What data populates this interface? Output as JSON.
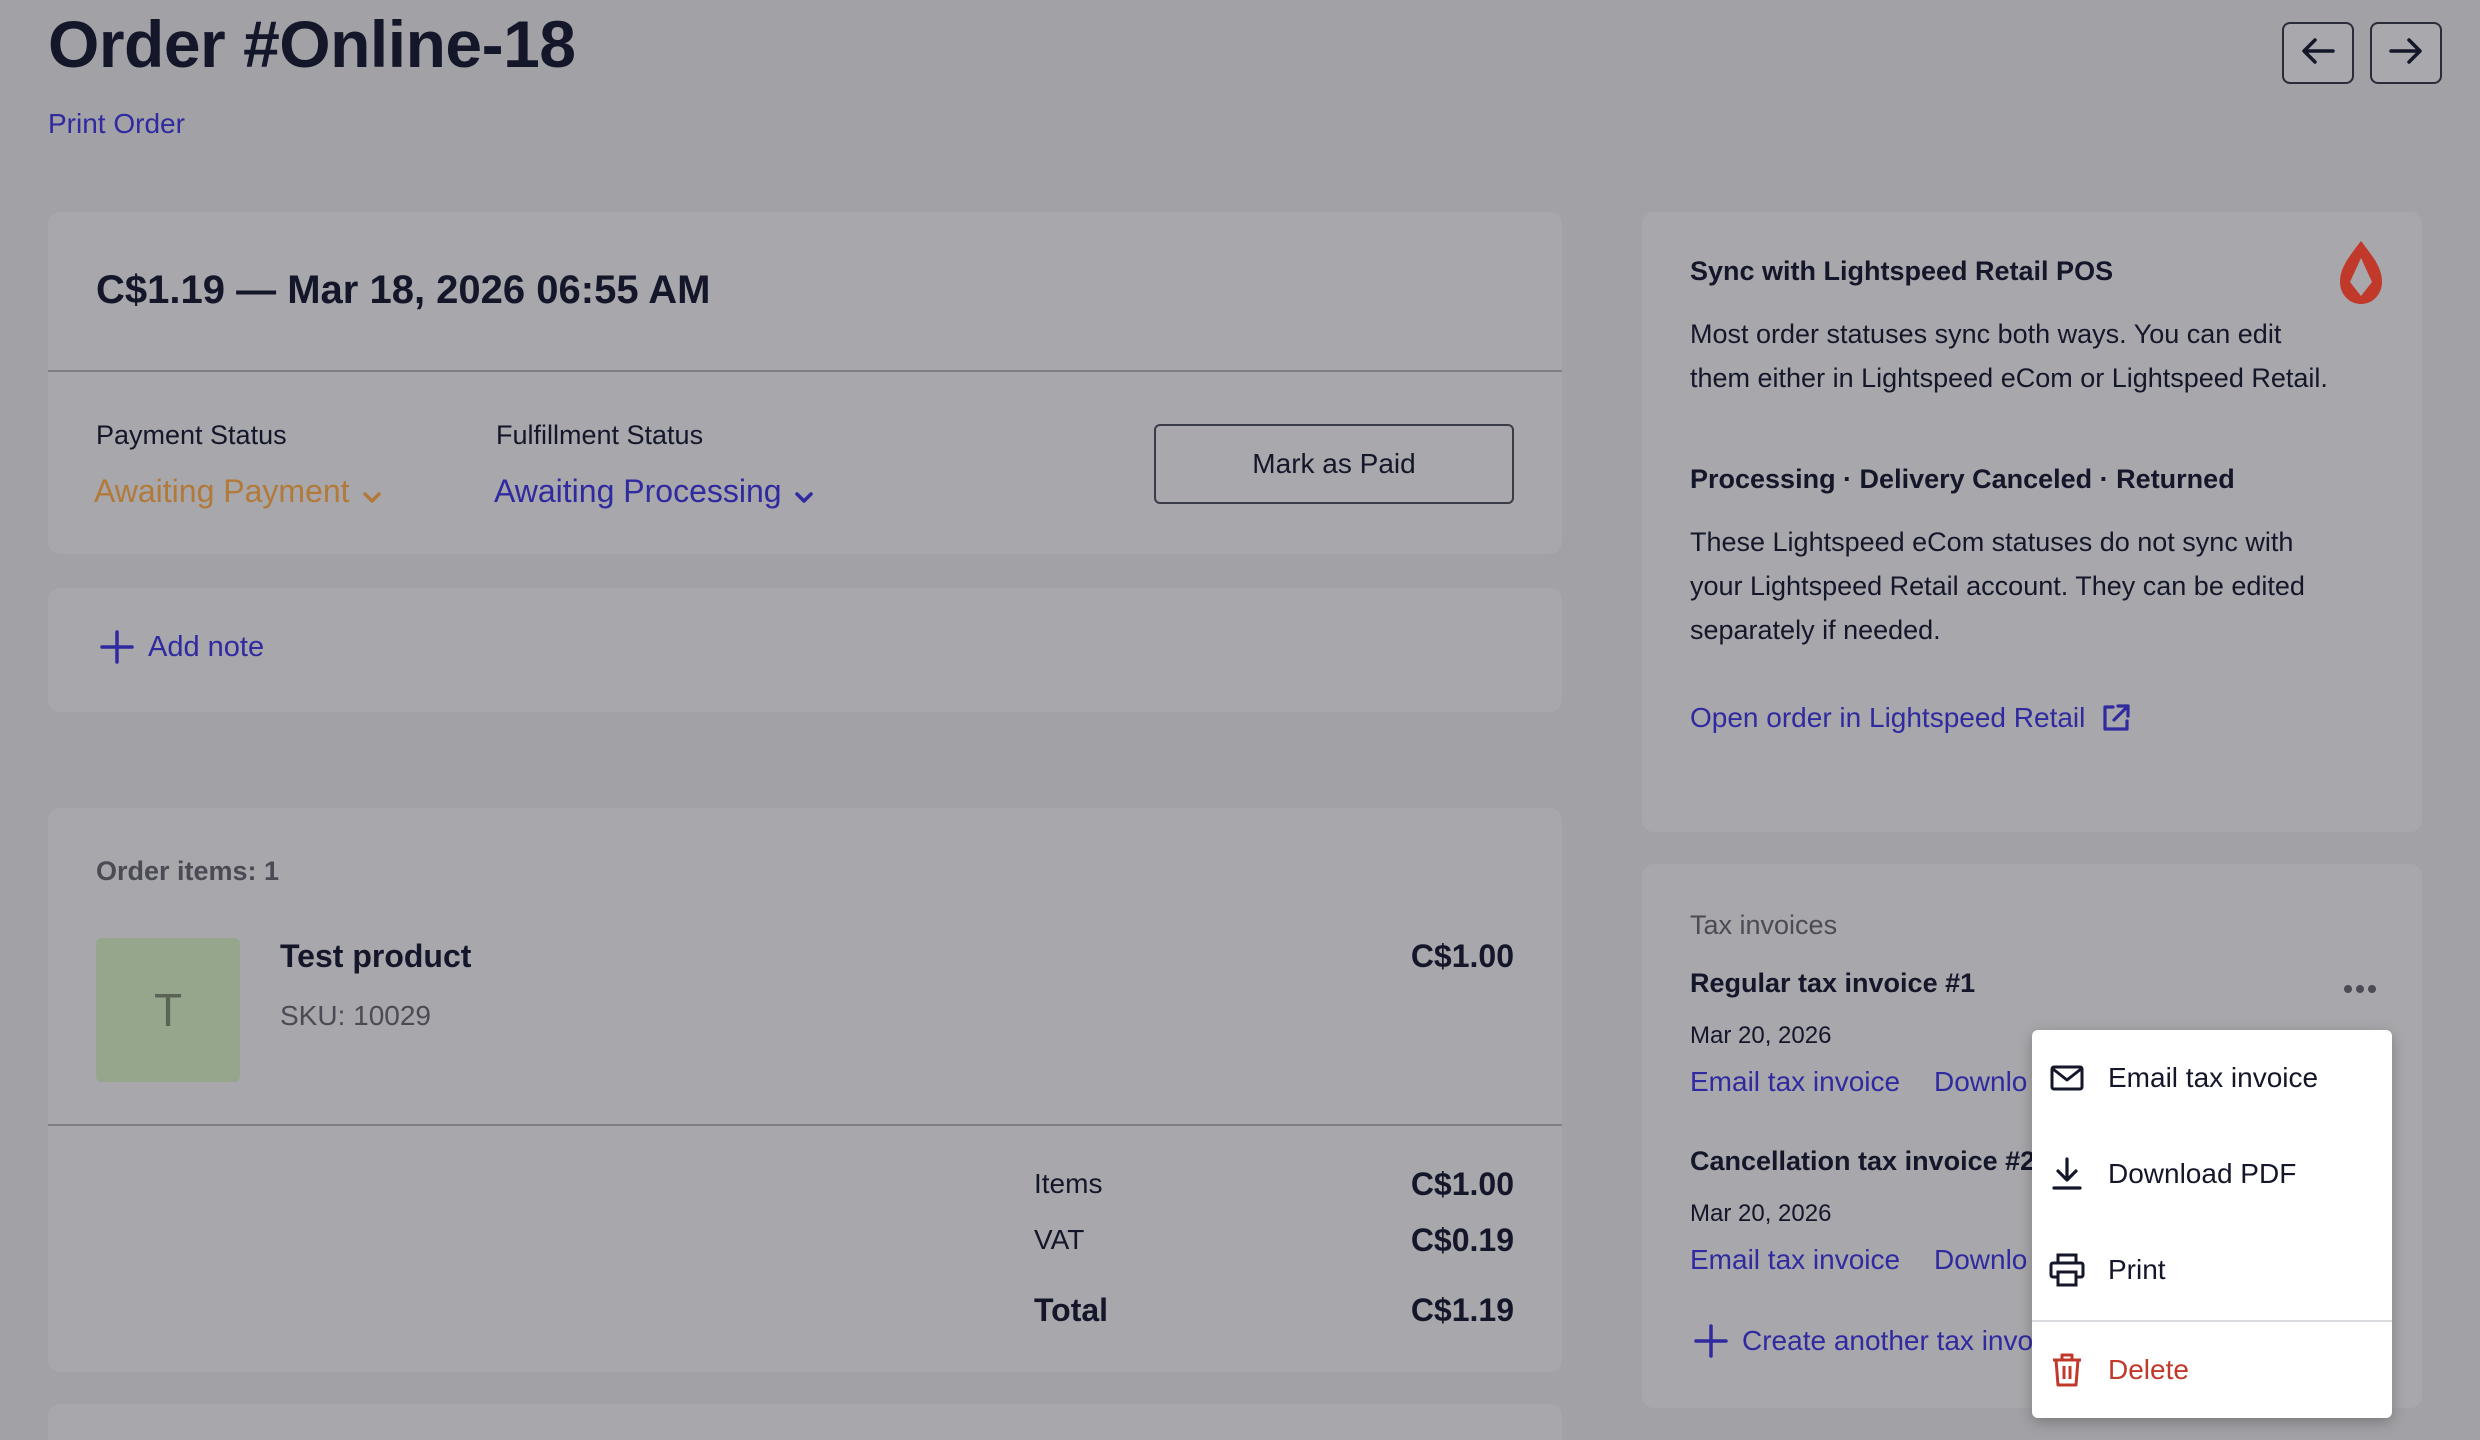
{
  "header": {
    "title": "Order #Online-18",
    "print_label": "Print Order",
    "prev_icon": "arrow-left-icon",
    "next_icon": "arrow-right-icon"
  },
  "summary": {
    "heading": "C$1.19 — Mar 18, 2026 06:55 AM",
    "payment_status_label": "Payment Status",
    "payment_status_value": "Awaiting Payment",
    "fulfillment_status_label": "Fulfillment Status",
    "fulfillment_status_value": "Awaiting Processing",
    "mark_paid_label": "Mark as Paid",
    "colors": {
      "payment": "#b27a3a",
      "fulfillment": "#2f2aa0"
    }
  },
  "note": {
    "add_label": "Add note"
  },
  "items": {
    "heading": "Order items: 1",
    "list": [
      {
        "thumb_letter": "T",
        "name": "Test product",
        "sku": "SKU: 10029",
        "price": "C$1.00"
      }
    ],
    "totals": [
      {
        "label": "Items",
        "value": "C$1.00"
      },
      {
        "label": "VAT",
        "value": "C$0.19"
      },
      {
        "label": "Total",
        "value": "C$1.19"
      }
    ]
  },
  "sync": {
    "title": "Sync with Lightspeed Retail POS",
    "text1": "Most order statuses sync both ways. You can edit them either in Lightspeed eCom or Lightspeed Retail.",
    "statuses": "Processing · Delivery Canceled · Returned",
    "text2": "These Lightspeed eCom statuses do not sync with your Lightspeed Retail account. They can be edited separately if needed.",
    "link": "Open order in Lightspeed Retail",
    "logo_icon": "lightspeed-flame-icon"
  },
  "tax": {
    "heading": "Tax invoices",
    "invoices": [
      {
        "title": "Regular tax invoice #1",
        "date": "Mar 20, 2026",
        "email": "Email tax invoice",
        "download": "Downlo"
      },
      {
        "title": "Cancellation tax invoice #2",
        "date": "Mar 20, 2026",
        "email": "Email tax invoice",
        "download": "Downlo"
      }
    ],
    "create_label": "Create another tax invo"
  },
  "menu": {
    "items": [
      {
        "label": "Email tax invoice",
        "icon": "envelope-icon"
      },
      {
        "label": "Download PDF",
        "icon": "download-icon"
      },
      {
        "label": "Print",
        "icon": "printer-icon"
      },
      {
        "label": "Delete",
        "icon": "trash-icon",
        "color": "#c0392b"
      }
    ]
  }
}
